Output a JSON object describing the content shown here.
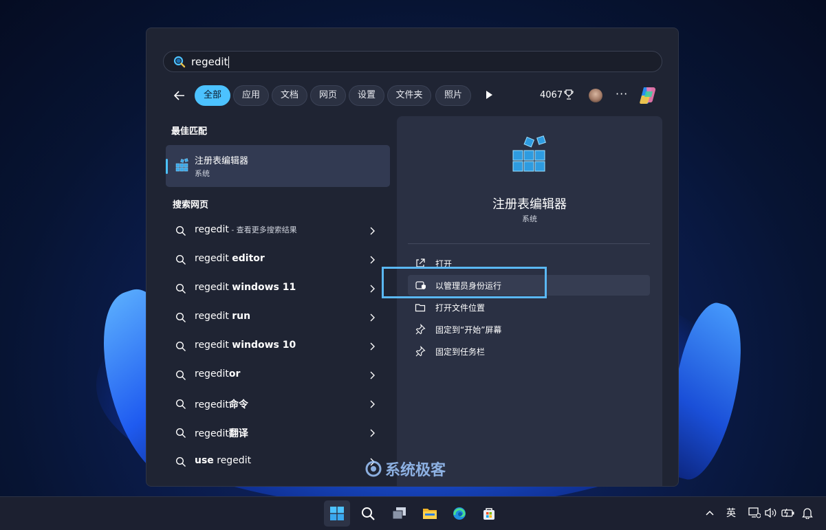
{
  "search": {
    "query": "regedit"
  },
  "filters": {
    "chips": [
      "全部",
      "应用",
      "文档",
      "网页",
      "设置",
      "文件夹",
      "照片"
    ],
    "active_index": 0,
    "points": "4067"
  },
  "best_match": {
    "heading": "最佳匹配",
    "name": "注册表编辑器",
    "type": "系统"
  },
  "web": {
    "heading": "搜索网页",
    "results": [
      {
        "prefix": "regedit",
        "bold": "",
        "suffix": " - 查看更多搜索结果"
      },
      {
        "prefix": "regedit ",
        "bold": "editor",
        "suffix": ""
      },
      {
        "prefix": "regedit ",
        "bold": "windows 11",
        "suffix": ""
      },
      {
        "prefix": "regedit ",
        "bold": "run",
        "suffix": ""
      },
      {
        "prefix": "regedit ",
        "bold": "windows 10",
        "suffix": ""
      },
      {
        "prefix": "regedit",
        "bold": "or",
        "suffix": ""
      },
      {
        "prefix": "regedit",
        "bold": "命令",
        "suffix": ""
      },
      {
        "prefix": "regedit",
        "bold": "翻译",
        "suffix": ""
      },
      {
        "prefix": "",
        "bold": "use",
        "suffix": " regedit"
      }
    ]
  },
  "preview": {
    "name": "注册表编辑器",
    "type": "系统",
    "actions": [
      {
        "label": "打开",
        "icon": "open-external-icon"
      },
      {
        "label": "以管理员身份运行",
        "icon": "shield-admin-icon"
      },
      {
        "label": "打开文件位置",
        "icon": "folder-open-icon"
      },
      {
        "label": "固定到“开始”屏幕",
        "icon": "pin-icon"
      },
      {
        "label": "固定到任务栏",
        "icon": "pin-icon"
      }
    ]
  },
  "watermark": "系统极客",
  "taskbar": {
    "apps": [
      "start-icon",
      "search-icon",
      "task-view-icon",
      "file-explorer-icon",
      "edge-icon",
      "store-icon"
    ],
    "tray": {
      "language": "英"
    }
  },
  "colors": {
    "accent": "#4cc2ff",
    "highlight": "#5ab8f5"
  }
}
